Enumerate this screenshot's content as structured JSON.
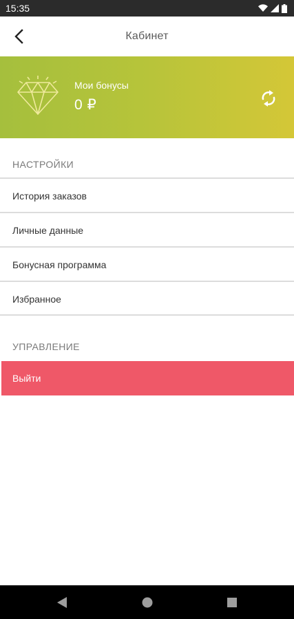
{
  "status_bar": {
    "time": "15:35"
  },
  "header": {
    "title": "Кабинет"
  },
  "bonus": {
    "label": "Мои бонусы",
    "value": "0 ₽"
  },
  "settings": {
    "title": "НАСТРОЙКИ",
    "items": [
      {
        "label": "История заказов"
      },
      {
        "label": "Личные данные"
      },
      {
        "label": "Бонусная программа"
      },
      {
        "label": "Избранное"
      }
    ]
  },
  "management": {
    "title": "УПРАВЛЕНИЕ",
    "logout_label": "Выйти"
  },
  "colors": {
    "bonus_gradient_start": "#a5bf3d",
    "bonus_gradient_end": "#d4c737",
    "logout": "#ef5868"
  }
}
